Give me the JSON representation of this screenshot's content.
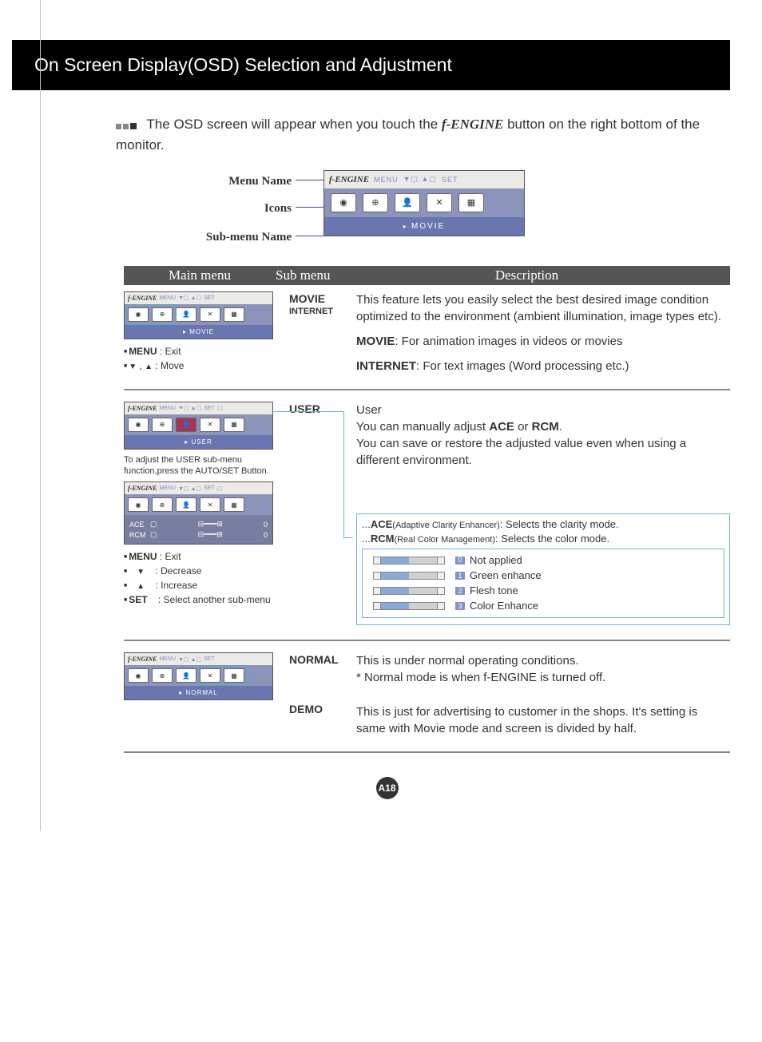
{
  "title": "On Screen Display(OSD) Selection and Adjustment",
  "intro_part1": "The OSD screen will appear when you touch the ",
  "intro_fengine": "f-ENGINE",
  "intro_part2": " button on the right bottom of the monitor.",
  "labels": {
    "menu_name": "Menu Name",
    "icons": "Icons",
    "sub_menu_name": "Sub-menu Name"
  },
  "osd": {
    "top_brand": "f-ENGINE",
    "tags": [
      "MENU",
      "SET"
    ],
    "sub_movie": "MOVIE",
    "sub_user": "USER",
    "sub_normal": "NORMAL",
    "ace": "ACE",
    "rcm": "RCM",
    "zero": "0"
  },
  "headers": {
    "main": "Main menu",
    "sub": "Sub menu",
    "desc": "Description"
  },
  "row1": {
    "sub1": "MOVIE",
    "sub2": "INTERNET",
    "desc1": "This feature lets you easily select the best desired image condition optimized to the environment (ambient illumination, image types etc).",
    "desc2a": "MOVIE",
    "desc2b": ": For animation images in videos or movies",
    "desc3a": "INTERNET",
    "desc3b": ": For text images (Word processing etc.)",
    "bul1": "MENU",
    "bul1b": " : Exit",
    "bul2": " : Move"
  },
  "row2": {
    "sub": "USER",
    "title": "User",
    "line1a": "You can manually adjust ",
    "line1b": "ACE",
    "line1c": " or ",
    "line1d": "RCM",
    "line1e": ".",
    "line2": "You can save or restore the adjusted value even when using a different environment.",
    "note": "To adjust the USER sub-menu function,press the AUTO/SET Button.",
    "ace_pre": "...",
    "ace_b": "ACE",
    "ace_s": "(Adaptive Clarity Enhancer)",
    "ace_t": ": Selects the clarity mode.",
    "rcm_b": "RCM",
    "rcm_s": "(Real Color Management)",
    "rcm_t": ": Selects the color mode.",
    "opts": [
      {
        "n": "0",
        "t": "Not applied"
      },
      {
        "n": "1",
        "t": "Green enhance"
      },
      {
        "n": "2",
        "t": "Flesh tone"
      },
      {
        "n": "3",
        "t": "Color Enhance"
      }
    ],
    "bul1": "MENU",
    "bul1b": " : Exit",
    "bul2": ": Decrease",
    "bul3": ": Increase",
    "bul4": "SET",
    "bul4b": " : Select another sub-menu"
  },
  "row3": {
    "sub1": "NORMAL",
    "desc1": "This is under normal operating conditions.",
    "desc1b": "* Normal mode is when f-ENGINE is turned off.",
    "sub2": "DEMO",
    "desc2": "This is just for advertising to customer in the shops. It's setting is same with Movie mode and screen is divided by half."
  },
  "page": "A18"
}
